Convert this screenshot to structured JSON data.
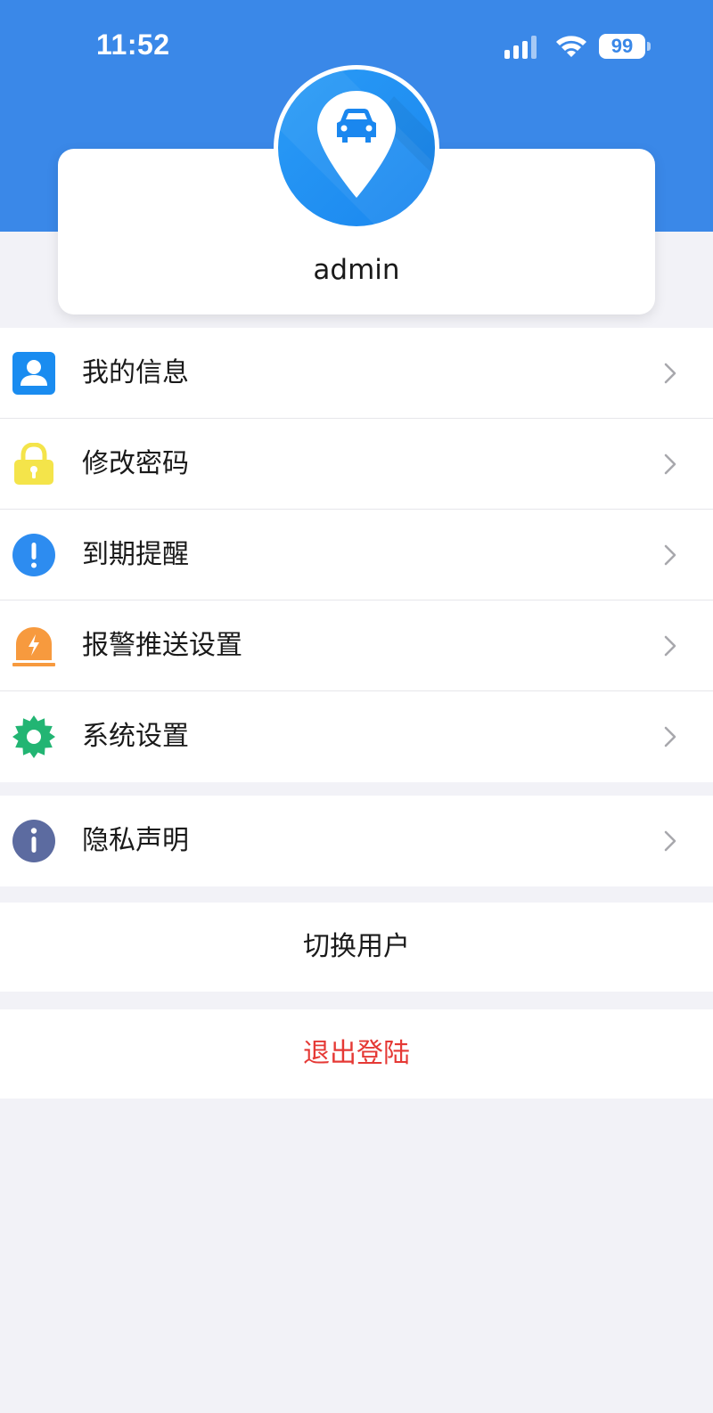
{
  "status_bar": {
    "time": "11:52",
    "battery": "99",
    "icons": [
      "signal-icon",
      "wifi-icon",
      "battery-icon"
    ]
  },
  "profile": {
    "username": "admin",
    "avatar_icon": "car-location-pin-icon"
  },
  "menu": {
    "items": [
      {
        "label": "我的信息",
        "icon": "user-icon",
        "color": "#1a8cf0"
      },
      {
        "label": "修改密码",
        "icon": "lock-icon",
        "color": "#f4e44a"
      },
      {
        "label": "到期提醒",
        "icon": "exclamation-icon",
        "color": "#2d8cf0"
      },
      {
        "label": "报警推送设置",
        "icon": "alarm-light-icon",
        "color": "#f79a3e"
      },
      {
        "label": "系统设置",
        "icon": "gear-icon",
        "color": "#22b573"
      }
    ],
    "privacy": {
      "label": "隐私声明",
      "icon": "info-icon",
      "color": "#5c6ba0"
    }
  },
  "actions": {
    "switch_user": "切换用户",
    "logout": "退出登陆"
  },
  "colors": {
    "header": "#3a88e8",
    "background": "#f2f2f7",
    "logout": "#e53935"
  }
}
